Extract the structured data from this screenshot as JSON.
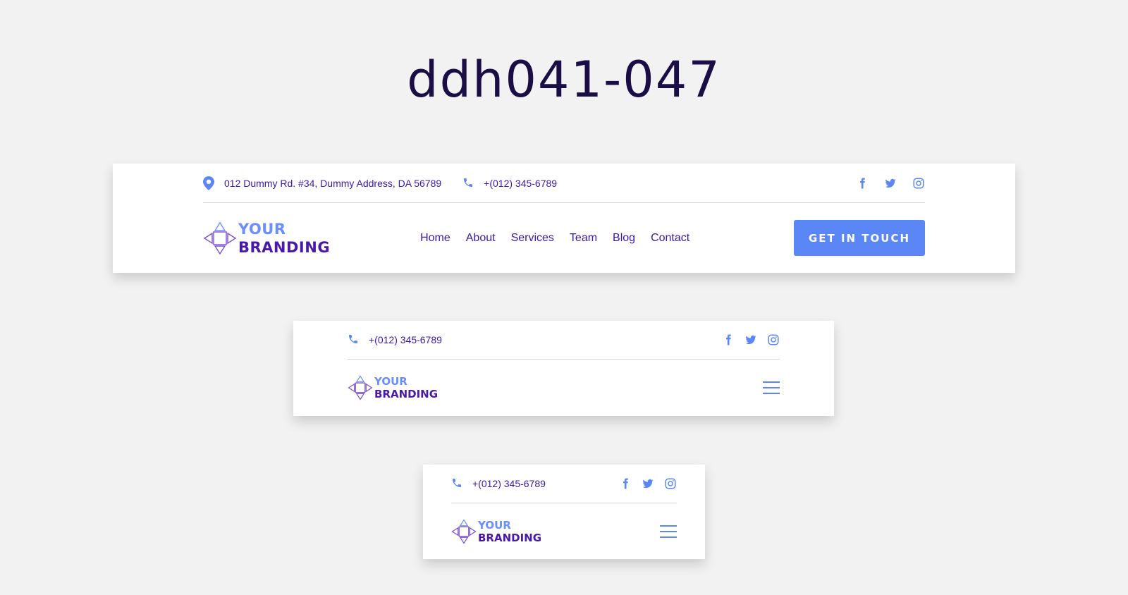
{
  "page_title": "ddh041-047",
  "colors": {
    "background": "#f2f2f2",
    "title": "#1b0d45",
    "text_primary": "#3d17a8",
    "accent_blue": "#5b86f5",
    "logo_light": "#6a8dff",
    "logo_dark": "#4a19a8"
  },
  "header_desktop": {
    "address": "012 Dummy Rd. #34, Dummy Address, DA 56789",
    "phone": "+(012) 345-6789",
    "social_icons": [
      "facebook-icon",
      "twitter-icon",
      "instagram-icon"
    ],
    "logo": {
      "line1": "YOUR",
      "line2": "BRANDING"
    },
    "nav": [
      "Home",
      "About",
      "Services",
      "Team",
      "Blog",
      "Contact"
    ],
    "cta_label": "GET IN TOUCH"
  },
  "header_tablet": {
    "phone": "+(012) 345-6789",
    "social_icons": [
      "facebook-icon",
      "twitter-icon",
      "instagram-icon"
    ],
    "logo": {
      "line1": "YOUR",
      "line2": "BRANDING"
    },
    "menu_icon": "hamburger-icon"
  },
  "header_mobile": {
    "phone": "+(012) 345-6789",
    "social_icons": [
      "facebook-icon",
      "twitter-icon",
      "instagram-icon"
    ],
    "logo": {
      "line1": "YOUR",
      "line2": "BRANDING"
    },
    "menu_icon": "hamburger-icon"
  }
}
